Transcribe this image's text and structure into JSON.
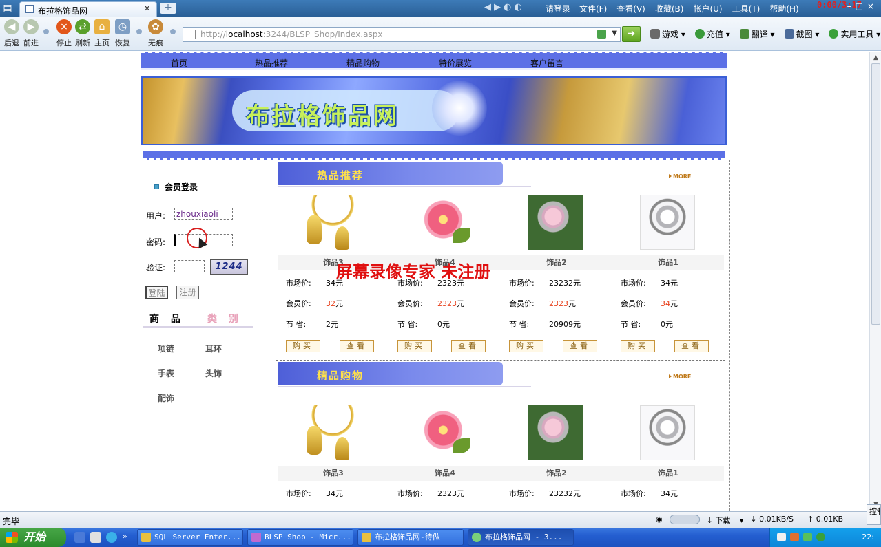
{
  "browser": {
    "tab_title": "布拉格饰品网",
    "tab_close": "×",
    "new_tab": "+",
    "login_text": "请登录",
    "menu": [
      "文件(F)",
      "查看(V)",
      "收藏(B)",
      "帐户(U)",
      "工具(T)",
      "帮助(H)"
    ],
    "clock": "0:00/3:17",
    "toolbar_buttons": [
      "后退",
      "前进",
      "停止",
      "刷新",
      "主页",
      "恢复",
      "无痕"
    ],
    "url_prefix": "http://",
    "url_host": "localhost",
    "url_rest": ":3244/BLSP_Shop/Index.aspx",
    "tools": [
      "游戏",
      "充值",
      "翻译",
      "截图",
      "实用工具"
    ]
  },
  "site": {
    "nav": [
      "首页",
      "热品推荐",
      "精品购物",
      "特价展览",
      "客户留言"
    ],
    "logo_text": "布拉格饰品网"
  },
  "login": {
    "title": "会员登录",
    "user_label": "用户:",
    "user_value": "zhouxiaoli",
    "password_label": "密码:",
    "password_value": "",
    "captcha_label": "验证:",
    "captcha_value": "",
    "captcha_code": "1244",
    "login_button": "登陆",
    "register_button": "注册"
  },
  "categories": {
    "header_a": "商 品",
    "header_b": "类 别",
    "items": [
      "项链",
      "耳环",
      "手表",
      "头饰",
      "配饰"
    ]
  },
  "sections": [
    {
      "title": "热品推荐",
      "more": "MORE",
      "products": [
        {
          "name": "饰品3",
          "image": "necklace",
          "market_label": "市场价:",
          "market": "34元",
          "member_label": "会员价:",
          "member_num": "32",
          "member_unit": "元",
          "save_label": "节 省:",
          "save": "2元",
          "buy": "购买",
          "view": "查看"
        },
        {
          "name": "饰品4",
          "image": "flower",
          "market_label": "市场价:",
          "market": "2323元",
          "member_label": "会员价:",
          "member_num": "2323",
          "member_unit": "元",
          "save_label": "节 省:",
          "save": "0元",
          "buy": "购买",
          "view": "查看"
        },
        {
          "name": "饰品2",
          "image": "brooch",
          "market_label": "市场价:",
          "market": "23232元",
          "member_label": "会员价:",
          "member_num": "2323",
          "member_unit": "元",
          "save_label": "节 省:",
          "save": "20909元",
          "buy": "购买",
          "view": "查看"
        },
        {
          "name": "饰品1",
          "image": "silver",
          "market_label": "市场价:",
          "market": "34元",
          "member_label": "会员价:",
          "member_num": "34",
          "member_unit": "元",
          "save_label": "节 省:",
          "save": "0元",
          "buy": "购买",
          "view": "查看"
        }
      ]
    },
    {
      "title": "精品购物",
      "more": "MORE",
      "products": [
        {
          "name": "饰品3",
          "image": "necklace",
          "market_label": "市场价:",
          "market": "34元"
        },
        {
          "name": "饰品4",
          "image": "flower",
          "market_label": "市场价:",
          "market": "2323元"
        },
        {
          "name": "饰品2",
          "image": "brooch",
          "market_label": "市场价:",
          "market": "23232元"
        },
        {
          "name": "饰品1",
          "image": "silver",
          "market_label": "市场价:",
          "market": "34元"
        }
      ]
    }
  ],
  "watermark": "屏幕录像专家 未注册",
  "statusbar": {
    "status": "完毕",
    "download": "下载",
    "down_speed": "0.01KB/S",
    "up_speed": "0.01KB"
  },
  "taskbar": {
    "start": "开始",
    "tasks": [
      "SQL Server Enter...",
      "BLSP_Shop - Micr...",
      "布拉格饰品网-待做",
      "布拉格饰品网 - 3..."
    ],
    "time": "22:",
    "side_panel": "控制"
  }
}
